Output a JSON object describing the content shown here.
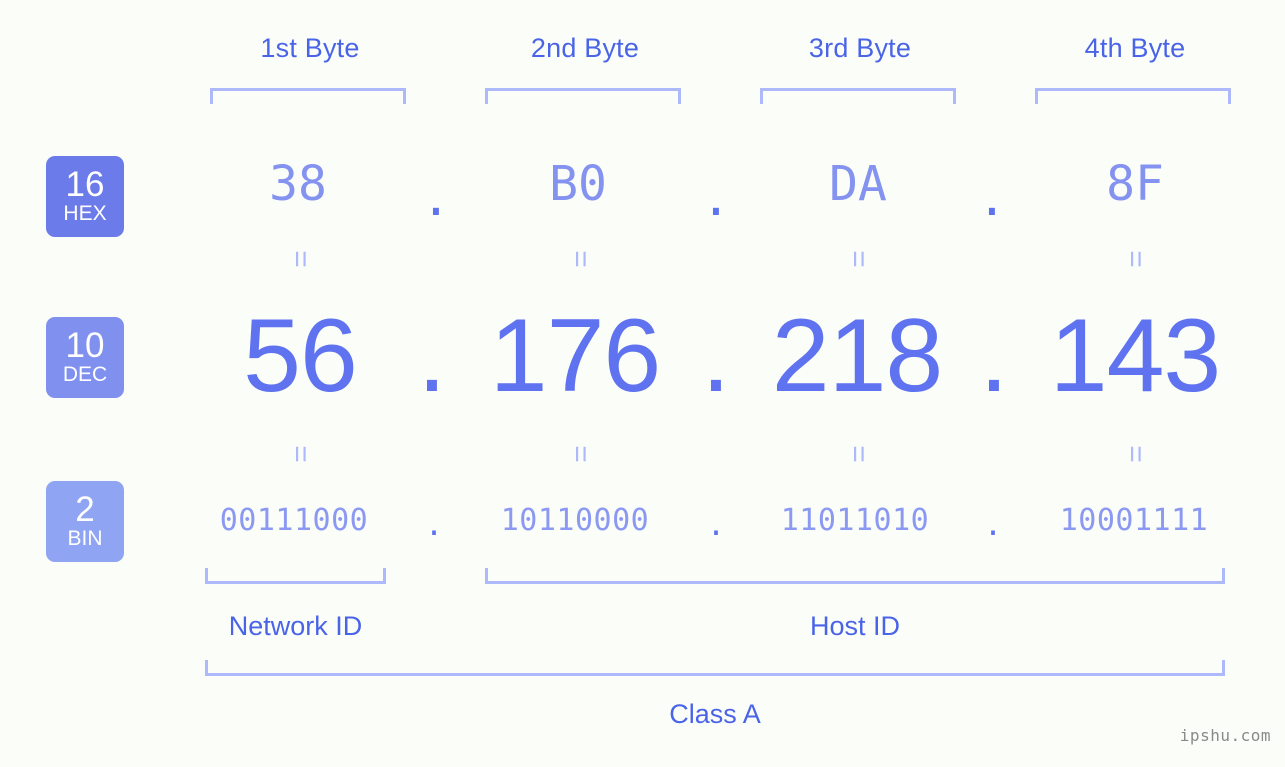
{
  "watermark": "ipshu.com",
  "colors": {
    "background": "#fbfdf8",
    "label_blue": "#4a64e8",
    "bracket_blue": "#aeb9fb",
    "hex_text": "#8492f0",
    "dec_text": "#5f72ef",
    "bin_text": "#8b99f3",
    "badge_hex": "#6c7bea",
    "badge_dec": "#7f90ef",
    "badge_bin": "#8fa4f2"
  },
  "byte_headers": [
    {
      "label": "1st Byte"
    },
    {
      "label": "2nd Byte"
    },
    {
      "label": "3rd Byte"
    },
    {
      "label": "4th Byte"
    }
  ],
  "bases": {
    "hex": {
      "number": "16",
      "name": "HEX"
    },
    "dec": {
      "number": "10",
      "name": "DEC"
    },
    "bin": {
      "number": "2",
      "name": "BIN"
    }
  },
  "separator": ".",
  "equals": "=",
  "rows": {
    "hex": {
      "octets": [
        "38",
        "B0",
        "DA",
        "8F"
      ]
    },
    "dec": {
      "octets": [
        "56",
        "176",
        "218",
        "143"
      ]
    },
    "bin": {
      "octets": [
        "00111000",
        "10110000",
        "11011010",
        "10001111"
      ]
    }
  },
  "sections": {
    "network_id": "Network ID",
    "host_id": "Host ID",
    "class": "Class A"
  }
}
